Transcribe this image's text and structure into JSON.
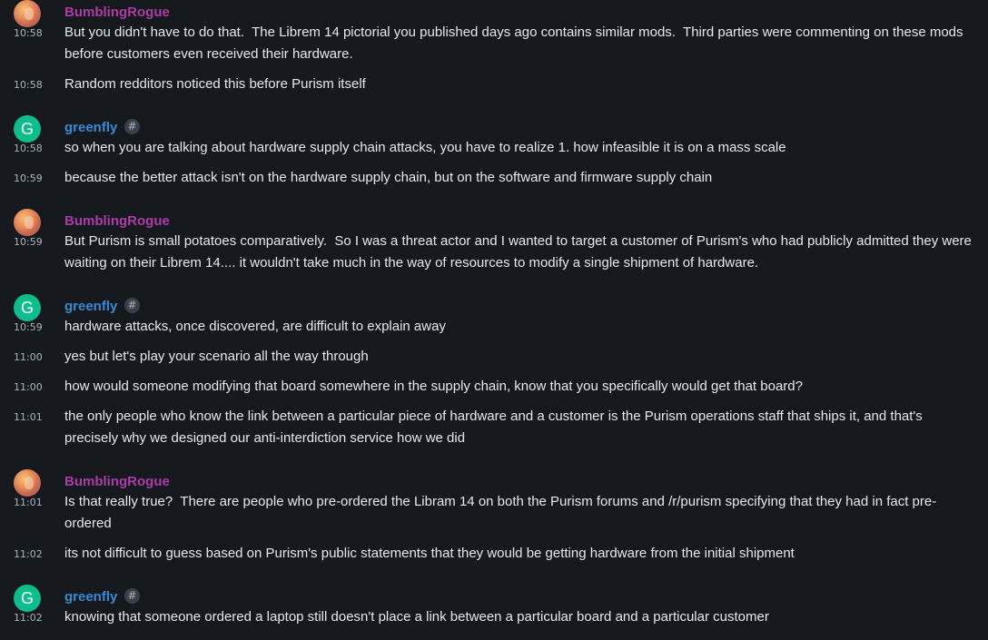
{
  "colors": {
    "background": "#15191e",
    "text": "#e6e8ea",
    "timestamp": "#a9b2bc",
    "bumbling_name": "#ac3ba8",
    "greenfly_name": "#368bd6",
    "greenfly_avatar": "#0dbd8b"
  },
  "users": {
    "bumbling": {
      "name": "BumblingRogue",
      "avatar_icon": "image-avatar"
    },
    "greenfly": {
      "name": "greenfly",
      "avatar_letter": "G",
      "badge": "#"
    }
  },
  "groups": [
    {
      "sender": "bumbling",
      "messages": [
        {
          "time": "10:58",
          "text": "But you didn't have to do that.  The Librem 14 pictorial you published days ago contains similar mods.  Third parties were commenting on these mods before customers even received their hardware."
        },
        {
          "time": "10:58",
          "text": "Random redditors noticed this before Purism itself"
        }
      ]
    },
    {
      "sender": "greenfly",
      "messages": [
        {
          "time": "10:58",
          "text": "so when you are talking about hardware supply chain attacks, you have to realize 1. how infeasible it is on a mass scale"
        },
        {
          "time": "10:59",
          "text": "because the better attack isn't on the hardware supply chain, but on the software and firmware supply chain"
        }
      ]
    },
    {
      "sender": "bumbling",
      "messages": [
        {
          "time": "10:59",
          "text": "But Purism is small potatoes comparatively.  So I was a threat actor and I wanted to target a customer of Purism's who had publicly admitted they were waiting on their Librem 14.... it wouldn't take much in the way of resources to modify a single shipment of hardware."
        }
      ]
    },
    {
      "sender": "greenfly",
      "messages": [
        {
          "time": "10:59",
          "text": "hardware attacks, once discovered, are difficult to explain away"
        },
        {
          "time": "11:00",
          "text": "yes but let's play your scenario all the way through"
        },
        {
          "time": "11:00",
          "text": "how would someone modifying that board somewhere in the supply chain, know that you specifically would get that board?"
        },
        {
          "time": "11:01",
          "text": "the only people who know the link between a particular piece of hardware and a customer is the Purism operations staff that ships it, and that's precisely why we designed our anti-interdiction service how we did"
        }
      ]
    },
    {
      "sender": "bumbling",
      "messages": [
        {
          "time": "11:01",
          "text": "Is that really true?  There are people who pre-ordered the Libram 14 on both the Purism forums and /r/purism specifying that they had in fact pre-ordered"
        },
        {
          "time": "11:02",
          "text": "its not difficult to guess based on Purism's public statements that they would be getting hardware from the initial shipment"
        }
      ]
    },
    {
      "sender": "greenfly",
      "messages": [
        {
          "time": "11:02",
          "text": "knowing that someone ordered a laptop still doesn't place a link between a particular board and a particular customer"
        }
      ]
    }
  ]
}
